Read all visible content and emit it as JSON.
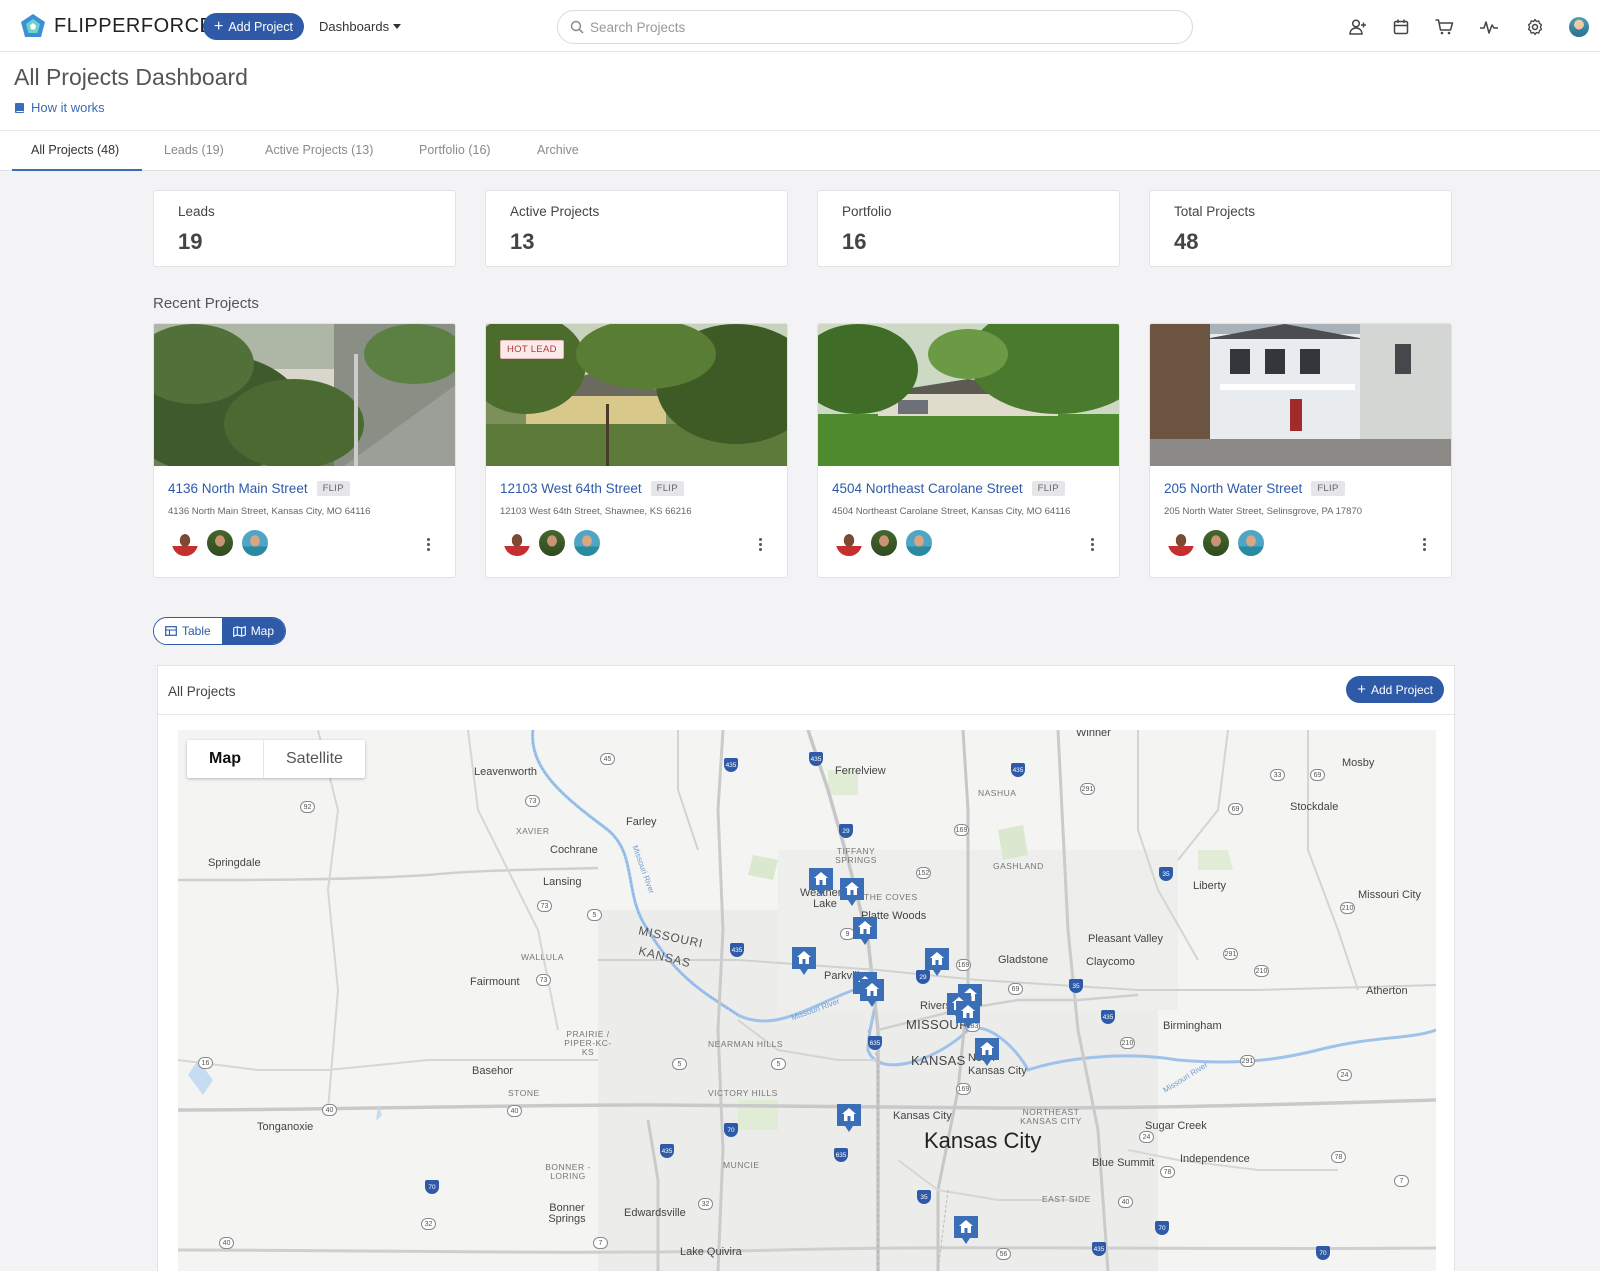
{
  "brand": {
    "name": "FLIPPERFORCE"
  },
  "topnav": {
    "add_project_label": "Add Project",
    "dashboards_label": "Dashboards",
    "search_placeholder": "Search Projects"
  },
  "header": {
    "title": "All Projects Dashboard",
    "how_link": "How it works"
  },
  "tabs": [
    {
      "label": "All Projects (48)"
    },
    {
      "label": "Leads (19)"
    },
    {
      "label": "Active Projects (13)"
    },
    {
      "label": "Portfolio (16)"
    },
    {
      "label": "Archive"
    }
  ],
  "stats": [
    {
      "label": "Leads",
      "value": "19"
    },
    {
      "label": "Active Projects",
      "value": "13"
    },
    {
      "label": "Portfolio",
      "value": "16"
    },
    {
      "label": "Total Projects",
      "value": "48"
    }
  ],
  "recent": {
    "title": "Recent Projects",
    "projects": [
      {
        "name": "4136 North Main Street",
        "tag": "FLIP",
        "address": "4136 North Main Street, Kansas City, MO 64116",
        "badge": ""
      },
      {
        "name": "12103 West 64th Street",
        "tag": "FLIP",
        "address": "12103 West 64th Street, Shawnee, KS 66216",
        "badge": "HOT LEAD"
      },
      {
        "name": "4504 Northeast Carolane Street",
        "tag": "FLIP",
        "address": "4504 Northeast Carolane Street, Kansas City, MO 64116",
        "badge": ""
      },
      {
        "name": "205 North Water Street",
        "tag": "FLIP",
        "address": "205 North Water Street, Selinsgrove, PA 17870",
        "badge": ""
      }
    ]
  },
  "view_toggle": {
    "table_label": "Table",
    "map_label": "Map"
  },
  "panel": {
    "title": "All Projects",
    "add_label": "Add Project"
  },
  "map": {
    "toggle_map": "Map",
    "toggle_satellite": "Satellite",
    "labels": {
      "winner": "Winner",
      "mosby": "Mosby",
      "ferrelview": "Ferrelview",
      "leavenworth": "Leavenworth",
      "nashua": "NASHUA",
      "stockdale": "Stockdale",
      "farley": "Farley",
      "xavier": "XAVIER",
      "cochrane": "Cochrane",
      "springdale": "Springdale",
      "tiffany": "TIFFANY SPRINGS",
      "gashland": "GASHLAND",
      "lansing": "Lansing",
      "liberty": "Liberty",
      "weatherby": "Weatherby Lake",
      "coves": "THE COVES",
      "missouri_city": "Missouri City",
      "platte": "Platte Woods",
      "missouri_state": "MISSOURI",
      "kansas_state": "KANSAS",
      "pleasant_valley": "Pleasant Valley",
      "wallula": "WALLULA",
      "gladstone": "Gladstone",
      "claycomo": "Claycomo",
      "fairmount": "Fairmount",
      "parkville": "Parkville",
      "atherton": "Atherton",
      "riverside": "Riverside",
      "missouri_small": "MISSOURI",
      "birmingham": "Birmingham",
      "prairie": "PRAIRIE / PIPER-KC-KS",
      "nearman": "NEARMAN HILLS",
      "kansas_small": "KANSAS",
      "north_kc": "North Kansas City",
      "basehor": "Basehor",
      "stone": "STONE",
      "victory": "VICTORY HILLS",
      "kck": "Kansas City",
      "ne_kc": "NORTHEAST KANSAS CITY",
      "sugar": "Sugar Creek",
      "tonganoxie": "Tonganoxie",
      "kansas_city": "Kansas City",
      "blue_summit": "Blue Summit",
      "independence": "Independence",
      "bonner": "BONNER - LORING",
      "muncie": "MUNCIE",
      "east_side": "EAST SIDE",
      "bonner_springs": "Bonner Springs",
      "edwardsville": "Edwardsville",
      "lake_quivira": "Lake Quivira",
      "missouri_river1": "Missouri River",
      "missouri_river2": "Missouri River",
      "missouri_river3": "Missouri River"
    }
  }
}
